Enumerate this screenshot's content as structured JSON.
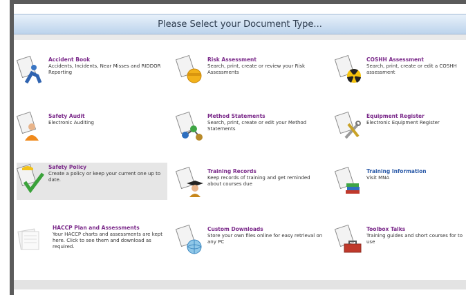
{
  "header": {
    "title": "Please Select your Document Type..."
  },
  "items": [
    {
      "title": "Accident Book",
      "desc": "Accidents, Incidents, Near Misses and RIDDOR Reporting",
      "icon": "accident-book-icon"
    },
    {
      "title": "Risk Assessment",
      "desc": "Search, print, create or review your Risk Assessments",
      "icon": "risk-assessment-icon"
    },
    {
      "title": "COSHH Assessment",
      "desc": "Search, print, create or edit a COSHH assessment",
      "icon": "coshh-hazard-icon"
    },
    {
      "title": "Safety Audit",
      "desc": "Electronic Auditing",
      "icon": "safety-audit-icon"
    },
    {
      "title": "Method Statements",
      "desc": "Search, print, create or edit your Method Statements",
      "icon": "method-statements-icon"
    },
    {
      "title": "Equipment Register",
      "desc": "Electronic Equipment Register",
      "icon": "equipment-register-icon"
    },
    {
      "title": "Safety Policy",
      "desc": "Create a policy or keep your current one up to date.",
      "icon": "safety-policy-icon"
    },
    {
      "title": "Training Records",
      "desc": "Keep records of training and get reminded about courses due",
      "icon": "training-records-icon"
    },
    {
      "title": "Training Information",
      "desc": "Visit MNA",
      "icon": "training-information-icon"
    },
    {
      "title": "HACCP Plan and Assessments",
      "desc": "Your HACCP charts and assessments are kept here. Click to see them and download as required.",
      "icon": "haccp-icon"
    },
    {
      "title": "Custom Downloads",
      "desc": "Store your own files online for easy retrieval on any PC",
      "icon": "custom-downloads-icon"
    },
    {
      "title": "Toolbox Talks",
      "desc": "Training guides and short courses for to use",
      "icon": "toolbox-talks-icon"
    }
  ],
  "colors": {
    "link": "#7b2a8a",
    "link_alt": "#2b5aa8",
    "header_text": "#2c3b4d"
  }
}
